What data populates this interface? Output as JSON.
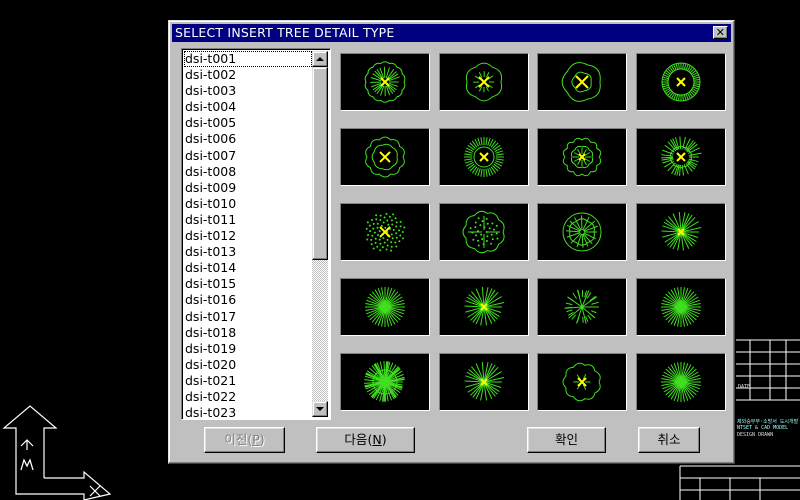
{
  "window": {
    "title": "SELECT INSERT TREE DETAIL TYPE",
    "close_label": "✕"
  },
  "list": {
    "selected": "dsi-t001",
    "items": [
      "dsi-t001",
      "dsi-t002",
      "dsi-t003",
      "dsi-t004",
      "dsi-t005",
      "dsi-t006",
      "dsi-t007",
      "dsi-t008",
      "dsi-t009",
      "dsi-t010",
      "dsi-t011",
      "dsi-t012",
      "dsi-t013",
      "dsi-t014",
      "dsi-t015",
      "dsi-t016",
      "dsi-t017",
      "dsi-t018",
      "dsi-t019",
      "dsi-t020",
      "dsi-t021",
      "dsi-t022",
      "dsi-t023"
    ]
  },
  "tiles": [
    {
      "style": "bushy"
    },
    {
      "style": "lobed"
    },
    {
      "style": "lobed-leaf"
    },
    {
      "style": "ring"
    },
    {
      "style": "cloud"
    },
    {
      "style": "spiky-circle"
    },
    {
      "style": "petal"
    },
    {
      "style": "sunburst"
    },
    {
      "style": "dotted"
    },
    {
      "style": "shrub"
    },
    {
      "style": "leafy"
    },
    {
      "style": "star"
    },
    {
      "style": "star-fine"
    },
    {
      "style": "star"
    },
    {
      "style": "twig"
    },
    {
      "style": "star-fine"
    },
    {
      "style": "dense-burst"
    },
    {
      "style": "star"
    },
    {
      "style": "cloud-small"
    },
    {
      "style": "star-fine"
    }
  ],
  "colors": {
    "tree": "#40e020",
    "center_mark": "#ffff00",
    "titlebar": "#000080",
    "cad_white": "#ffffff"
  },
  "buttons": {
    "prev": {
      "text": "이전",
      "hotkey": "P",
      "enabled": false
    },
    "next": {
      "text": "다음",
      "hotkey": "N",
      "enabled": true
    },
    "ok": {
      "text": "확인"
    },
    "cancel": {
      "text": "취소"
    }
  },
  "background": {
    "ucs_label": "Y",
    "titleblock_lines": [
      "DATE",
      "제외승무부·소방서 도시개발",
      "NTSET & CAD MODEL",
      "DESIGN    DRAWN"
    ]
  }
}
